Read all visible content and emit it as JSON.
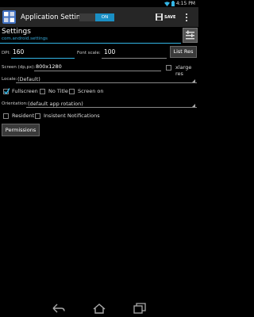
{
  "status": {
    "time": "4:15 PM"
  },
  "action_bar": {
    "title": "Application Settings",
    "toggle_on": "ON",
    "save": "SAVE"
  },
  "header": {
    "title": "Settings",
    "package": "com.android.settings"
  },
  "dpi": {
    "label": "DPI:",
    "value": "160"
  },
  "font_scale": {
    "label": "Font scale:",
    "value": "100"
  },
  "list_res": "List Res",
  "screen": {
    "label": "Screen (dp,px):",
    "value": "800x1280"
  },
  "xlarge": {
    "label": "xlarge res"
  },
  "locale": {
    "label": "Locale:",
    "value": "(Default)"
  },
  "options": {
    "fullscreen": "Fullscreen",
    "no_title": "No Title",
    "screen_on": "Screen on",
    "resident": "Resident",
    "insistent": "Insistent Notifications"
  },
  "orientation": {
    "label": "Orientation:",
    "value": "(default app rotation)"
  },
  "permissions": "Permissions",
  "colors": {
    "accent": "#33b5e5",
    "toggle": "#1a8fc4",
    "background": "#000000"
  },
  "icons": [
    "wifi-icon",
    "battery-icon",
    "app-icon",
    "save-icon",
    "overflow-icon",
    "settings-list-icon",
    "back-icon",
    "home-icon",
    "recents-icon"
  ]
}
